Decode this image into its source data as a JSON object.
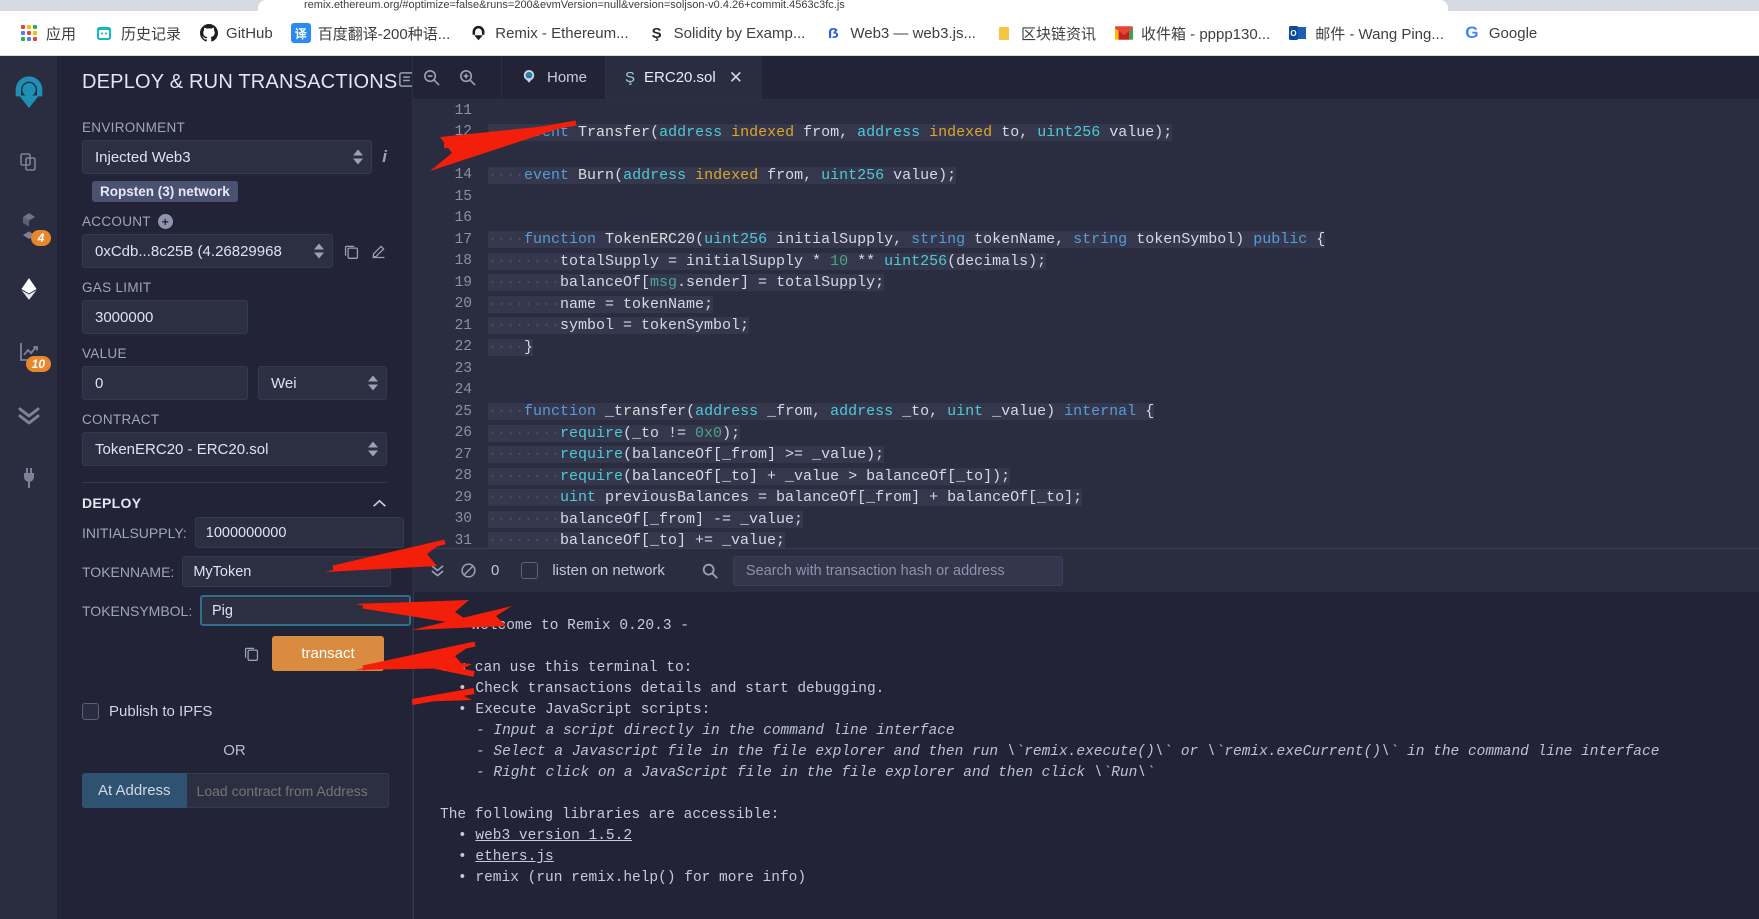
{
  "browser": {
    "tab_title": "remix.ethereum.org/#optimize=false&runs=200&evmVersion=null&version=soljson-v0.4.26+commit.4563c3fc.js",
    "bookmarks": [
      {
        "label": "应用",
        "icon": "apps-grid-icon"
      },
      {
        "label": "历史记录",
        "icon": "history-icon"
      },
      {
        "label": "GitHub",
        "icon": "github-icon"
      },
      {
        "label": "百度翻译-200种语...",
        "icon": "baidu-translate-icon"
      },
      {
        "label": "Remix - Ethereum...",
        "icon": "remix-icon"
      },
      {
        "label": "Solidity by Examp...",
        "icon": "solidity-icon"
      },
      {
        "label": "Web3 — web3.js...",
        "icon": "web3-icon"
      },
      {
        "label": "区块链资讯",
        "icon": "folder-icon"
      },
      {
        "label": "收件箱 - pppp130...",
        "icon": "gmail-icon"
      },
      {
        "label": "邮件 - Wang Ping...",
        "icon": "outlook-icon"
      },
      {
        "label": "Google",
        "icon": "google-icon"
      }
    ]
  },
  "rail": {
    "items": [
      {
        "name": "remix-logo",
        "badge": null
      },
      {
        "name": "file-explorer-icon",
        "badge": null
      },
      {
        "name": "solidity-compiler-icon",
        "badge": "4"
      },
      {
        "name": "deploy-run-icon",
        "badge": null
      },
      {
        "name": "analysis-icon",
        "badge": "10"
      },
      {
        "name": "testing-icon",
        "badge": null
      },
      {
        "name": "plugin-manager-icon",
        "badge": null
      }
    ]
  },
  "panel": {
    "title": "DEPLOY & RUN TRANSACTIONS",
    "environment": {
      "label": "ENVIRONMENT",
      "value": "Injected Web3",
      "network_badge": "Ropsten (3) network"
    },
    "account": {
      "label": "ACCOUNT",
      "value": "0xCdb...8c25B (4.26829968"
    },
    "gas_limit": {
      "label": "GAS LIMIT",
      "value": "3000000"
    },
    "value_field": {
      "label": "VALUE",
      "value": "0",
      "unit": "Wei"
    },
    "contract": {
      "label": "CONTRACT",
      "value": "TokenERC20 - ERC20.sol"
    },
    "deploy": {
      "heading": "DEPLOY",
      "args": [
        {
          "label": "INITIALSUPPLY:",
          "value": "1000000000",
          "focused": false
        },
        {
          "label": "TOKENNAME:",
          "value": "MyToken",
          "focused": false
        },
        {
          "label": "TOKENSYMBOL:",
          "value": "Pig",
          "focused": true
        }
      ],
      "transact_label": "transact"
    },
    "publish_ipfs_label": "Publish to IPFS",
    "or_label": "OR",
    "at_address_label": "At Address",
    "at_address_placeholder": "Load contract from Address"
  },
  "editor": {
    "home_tab": "Home",
    "file_tab": "ERC20.sol",
    "lines": [
      {
        "n": "11",
        "html": ""
      },
      {
        "n": "12",
        "html": "<span class='hl'><span class='dot'>····</span><span class='kw'>event</span> <span class='fn'>Transfer</span>(<span class='typ'>address</span> <span class='ind'>indexed</span> from, <span class='typ'>address</span> <span class='ind'>indexed</span> to, <span class='typ'>uint256</span> value);</span>"
      },
      {
        "n": "13",
        "html": ""
      },
      {
        "n": "14",
        "html": "<span class='hl'><span class='dot'>····</span><span class='kw'>event</span> <span class='fn'>Burn</span>(<span class='typ'>address</span> <span class='ind'>indexed</span> from, <span class='typ'>uint256</span> value);</span>"
      },
      {
        "n": "15",
        "html": ""
      },
      {
        "n": "16",
        "html": ""
      },
      {
        "n": "17",
        "html": "<span class='hl'><span class='dot'>····</span><span class='kw'>function</span> <span class='fn'>TokenERC20</span>(<span class='typ'>uint256</span> initialSupply, <span class='kw'>string</span> tokenName, <span class='kw'>string</span> tokenSymbol) <span class='kw'>public</span> {</span>"
      },
      {
        "n": "18",
        "html": "<span class='hl'><span class='dot'>········</span>totalSupply = initialSupply * <span class='num'>10</span> ** <span class='typ'>uint256</span>(decimals);</span>"
      },
      {
        "n": "19",
        "html": "<span class='hl'><span class='dot'>········</span>balanceOf[<span class='msg'>msg</span>.sender] = totalSupply;</span>"
      },
      {
        "n": "20",
        "html": "<span class='hl'><span class='dot'>········</span>name = tokenName;</span>"
      },
      {
        "n": "21",
        "html": "<span class='hl'><span class='dot'>········</span>symbol = tokenSymbol;</span>"
      },
      {
        "n": "22",
        "html": "<span class='hl'><span class='dot'>····</span>}</span>"
      },
      {
        "n": "23",
        "html": ""
      },
      {
        "n": "24",
        "html": ""
      },
      {
        "n": "25",
        "html": "<span class='hl'><span class='dot'>····</span><span class='kw'>function</span> <span class='fn'>_transfer</span>(<span class='typ'>address</span> _from, <span class='typ'>address</span> _to, <span class='typ'>uint</span> _value) <span class='kw'>internal</span> {</span>"
      },
      {
        "n": "26",
        "html": "<span class='hl'><span class='dot'>········</span><span class='typ'>require</span>(_to != <span class='num'>0x0</span>);</span>"
      },
      {
        "n": "27",
        "html": "<span class='hl'><span class='dot'>········</span><span class='typ'>require</span>(balanceOf[_from] &gt;= _value);</span>"
      },
      {
        "n": "28",
        "html": "<span class='hl'><span class='dot'>········</span><span class='typ'>require</span>(balanceOf[_to] + _value &gt; balanceOf[_to]);</span>"
      },
      {
        "n": "29",
        "html": "<span class='hl'><span class='dot'>········</span><span class='typ'>uint</span> previousBalances = balanceOf[_from] + balanceOf[_to];</span>"
      },
      {
        "n": "30",
        "html": "<span class='hl'><span class='dot'>········</span>balanceOf[_from] -= _value;</span>"
      },
      {
        "n": "31",
        "html": "<span class='hl'><span class='dot'>········</span>balanceOf[_to] += _value;</span>"
      }
    ]
  },
  "terminal": {
    "toolbar": {
      "pending_count": "0",
      "listen_label": "listen on network",
      "search_placeholder": "Search with transaction hash or address"
    },
    "welcome": "- Welcome to Remix 0.20.3 -",
    "intro": "You can use this terminal to:",
    "bullets": [
      "Check transactions details and start debugging.",
      "Execute JavaScript scripts:"
    ],
    "sub_bullets": [
      "Input a script directly in the command line interface",
      "Select a Javascript file in the file explorer and then run \\`remix.execute()\\` or \\`remix.exeCurrent()\\`  in the command line interface",
      "Right click on a JavaScript file in the file explorer and then click \\`Run\\`"
    ],
    "libs_intro": "The following libraries are accessible:",
    "libs": [
      "web3 version 1.5.2",
      "ethers.js"
    ],
    "last_line": "remix (run remix.help() for more info)"
  },
  "colors": {
    "accent_orange": "#d98b3f",
    "badge_orange": "#e8872c",
    "panel_bg": "#222336",
    "arrow_red": "#f41f0a"
  }
}
